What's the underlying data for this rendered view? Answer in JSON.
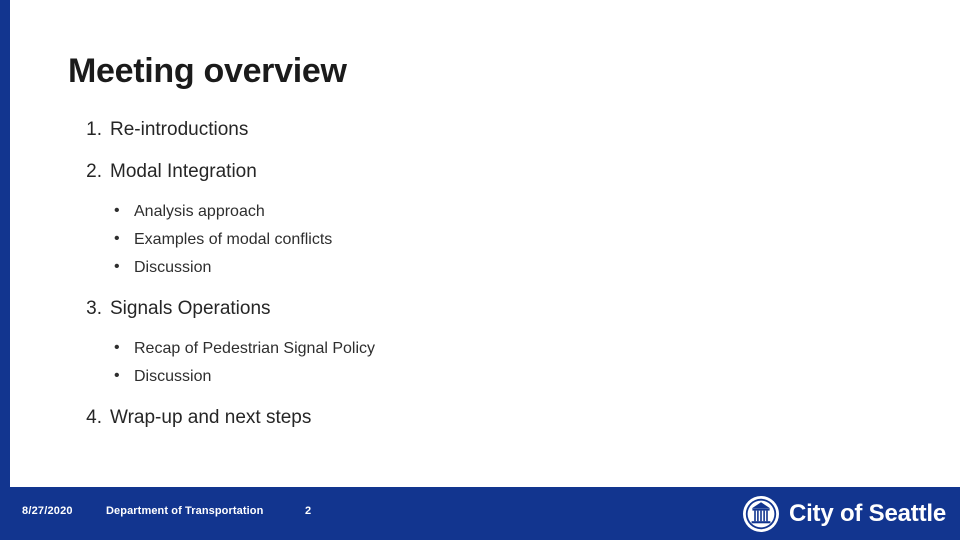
{
  "slide": {
    "title": "Meeting overview",
    "items": [
      {
        "number": "1.",
        "text": "Re-introductions",
        "subitems": []
      },
      {
        "number": "2.",
        "text": "Modal Integration",
        "subitems": [
          "Analysis approach",
          "Examples of modal conflicts",
          "Discussion"
        ]
      },
      {
        "number": "3.",
        "text": "Signals Operations",
        "subitems": [
          "Recap of Pedestrian Signal Policy",
          "Discussion"
        ]
      },
      {
        "number": "4.",
        "text": "Wrap-up and next steps",
        "subitems": []
      }
    ],
    "bullet_glyph": "•"
  },
  "footer": {
    "date": "8/27/2020",
    "department": "Department of Transportation",
    "page_number": "2",
    "brand_name": "City of Seattle",
    "brand_seal_icon": "city-seal-icon"
  },
  "colors": {
    "brand_blue": "#12358f",
    "text_dark": "#1b1b1b",
    "footer_text": "#ffffff"
  }
}
